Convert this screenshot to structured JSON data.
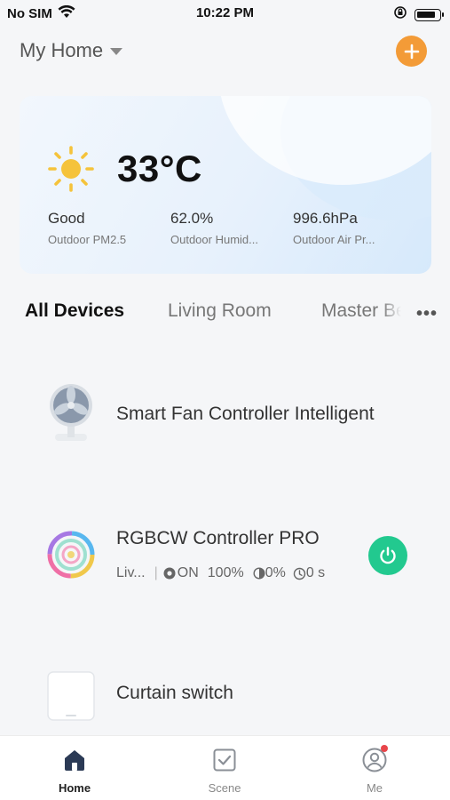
{
  "status_bar": {
    "carrier": "No SIM",
    "time": "10:22 PM"
  },
  "header": {
    "home_name": "My Home"
  },
  "weather": {
    "temperature": "33°C",
    "metrics": [
      {
        "value": "Good",
        "label": "Outdoor PM2.5"
      },
      {
        "value": "62.0%",
        "label": "Outdoor Humid..."
      },
      {
        "value": "996.6hPa",
        "label": "Outdoor Air Pr..."
      }
    ]
  },
  "tabs": [
    "All Devices",
    "Living Room",
    "Master Bedroom"
  ],
  "devices": [
    {
      "name": "Smart Fan Controller Intelligent",
      "icon": "fan-icon"
    },
    {
      "name": "RGBCW Controller PRO",
      "icon": "rgb-ring-icon",
      "room": "Liv...",
      "state": "ON",
      "brightness": "100%",
      "color_temp": "0%",
      "timer": "0 s"
    },
    {
      "name": "Curtain switch",
      "icon": "curtain-switch-icon"
    }
  ],
  "bottom_nav": [
    {
      "label": "Home",
      "icon": "home-icon",
      "active": true
    },
    {
      "label": "Scene",
      "icon": "scene-check-icon",
      "active": false
    },
    {
      "label": "Me",
      "icon": "profile-icon",
      "active": false
    }
  ],
  "colors": {
    "accent_orange": "#f39b37",
    "power_green": "#22c98f",
    "badge_red": "#e8454a",
    "nav_active": "#2b3a55"
  }
}
